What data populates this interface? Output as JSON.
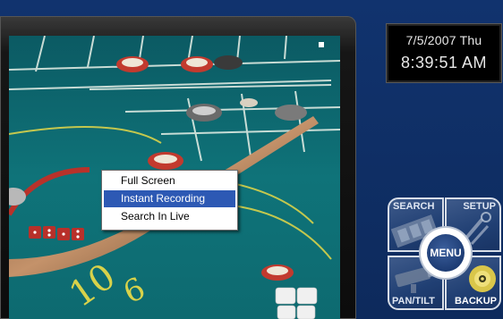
{
  "clock": {
    "date": "7/5/2007 Thu",
    "time": "8:39:51 AM"
  },
  "context_menu": {
    "items": [
      {
        "label": "Full Screen",
        "selected": false
      },
      {
        "label": "Instant Recording",
        "selected": true
      },
      {
        "label": "Search In Live",
        "selected": false
      }
    ]
  },
  "controls": {
    "search_label": "SEARCH",
    "setup_label": "SETUP",
    "pantilt_label": "PAN/TILT",
    "backup_label": "BACKUP",
    "menu_label": "MENU"
  },
  "video": {
    "table_numbers": [
      "10",
      "6"
    ]
  },
  "colors": {
    "background": "#0f2e63",
    "felt": "#0f6e74",
    "menu_highlight": "#2d59b4"
  }
}
